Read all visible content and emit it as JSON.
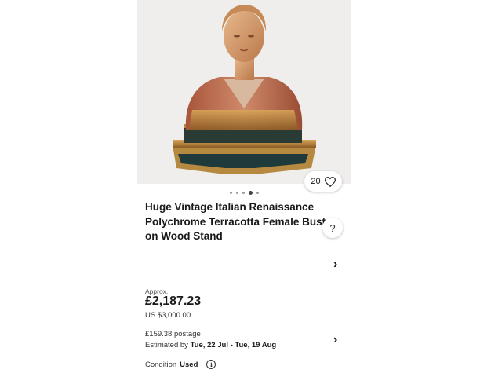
{
  "listing": {
    "image": {
      "carousel_count": 5,
      "active_index": 3
    },
    "watchers": {
      "count": "20",
      "icon": "heart-icon"
    },
    "title": "Huge Vintage Italian Renaissance Polychrome Terracotta Female Bust on Wood Stand",
    "help_icon_text": "?",
    "price": {
      "approx_label": "Approx.",
      "amount": "£2,187.23",
      "original": "US $3,000.00"
    },
    "shipping": {
      "postage": "£159.38 postage",
      "estimated_prefix": "Estimated by ",
      "estimated_dates": "Tue, 22 Jul - Tue, 19 Aug"
    },
    "condition": {
      "label": "Condition",
      "value": "Used",
      "info_icon": "i"
    },
    "chevron": "›"
  }
}
